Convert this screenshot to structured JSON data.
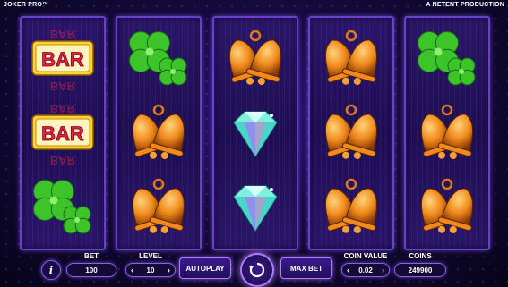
{
  "header": {
    "game_title": "JOKER PRO™",
    "producer": "A NETENT PRODUCTION"
  },
  "reels": [
    [
      "bar",
      "bar",
      "clover"
    ],
    [
      "clover",
      "bell",
      "bell"
    ],
    [
      "bell",
      "diamond",
      "diamond"
    ],
    [
      "bell",
      "bell",
      "bell"
    ],
    [
      "clover",
      "bell",
      "bell"
    ]
  ],
  "symbols": {
    "bar_text": "BAR"
  },
  "controls": {
    "info_label": "i",
    "bet_label": "BET",
    "bet_value": "100",
    "level_label": "LEVEL",
    "level_value": "10",
    "autoplay_label": "AUTOPLAY",
    "max_bet_label": "MAX BET",
    "coin_value_label": "COIN VALUE",
    "coin_value": "0.02",
    "coins_label": "COINS",
    "coins_value": "249900",
    "decrease_arrow": "‹",
    "increase_arrow": "›"
  },
  "colors": {
    "reel_border": "#6a3fd0",
    "accent": "#b07cff",
    "bell": "#f08a1c",
    "clover": "#3cc42a",
    "diamond": "#7ff0e0",
    "bar_red": "#e0224a",
    "bar_gold": "#ffd23a"
  }
}
